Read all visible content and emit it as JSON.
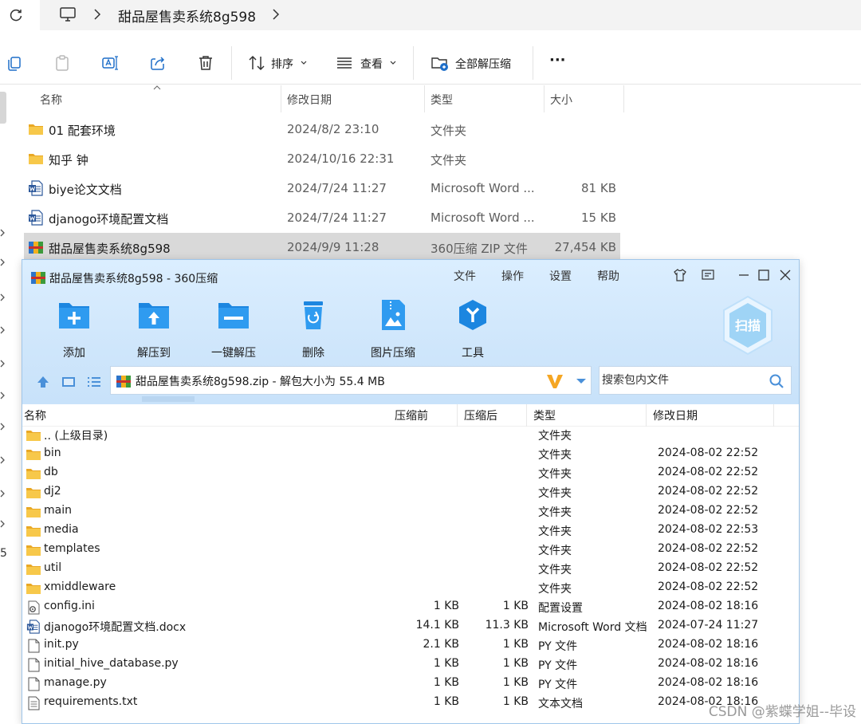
{
  "explorer": {
    "breadcrumb": "甜品屋售卖系统8g598",
    "toolbar": {
      "sort_label": "排序",
      "view_label": "查看",
      "extract_all_label": "全部解压缩",
      "more_label": "···"
    },
    "columns": {
      "name": "名称",
      "date": "修改日期",
      "type": "类型",
      "size": "大小"
    },
    "files": [
      {
        "name": "01 配套环境",
        "date": "2024/8/2 23:10",
        "type": "文件夹",
        "size": "",
        "icon": "folder-icon"
      },
      {
        "name": "知乎 钟",
        "date": "2024/10/16 22:31",
        "type": "文件夹",
        "size": "",
        "icon": "folder-icon"
      },
      {
        "name": "biye论文文档",
        "date": "2024/7/24 11:27",
        "type": "Microsoft Word ...",
        "size": "81 KB",
        "icon": "word-doc-icon"
      },
      {
        "name": "djanogo环境配置文档",
        "date": "2024/7/24 11:27",
        "type": "Microsoft Word ...",
        "size": "15 KB",
        "icon": "word-doc-icon"
      },
      {
        "name": "甜品屋售卖系统8g598",
        "date": "2024/9/9 11:28",
        "type": "360压缩 ZIP 文件",
        "size": "27,454 KB",
        "icon": "zip-archive-icon",
        "selected": true
      }
    ],
    "left_glyph": "5"
  },
  "zip": {
    "title": "甜品屋售卖系统8g598 - 360压缩",
    "menu": [
      "文件",
      "操作",
      "设置",
      "帮助"
    ],
    "tools": [
      {
        "label": "添加",
        "icon": "add-icon"
      },
      {
        "label": "解压到",
        "icon": "extract-to-icon"
      },
      {
        "label": "一键解压",
        "icon": "one-click-extract-icon"
      },
      {
        "label": "删除",
        "icon": "delete-icon"
      },
      {
        "label": "图片压缩",
        "icon": "image-compress-icon"
      },
      {
        "label": "工具",
        "icon": "tools-icon"
      }
    ],
    "scan_label": "扫描",
    "path_text": "甜品屋售卖系统8g598.zip - 解包大小为 55.4 MB",
    "search_placeholder": "搜索包内文件",
    "columns": {
      "name": "名称",
      "before": "压缩前",
      "after": "压缩后",
      "type": "类型",
      "date": "修改日期"
    },
    "rows": [
      {
        "name": ".. (上级目录)",
        "before": "",
        "after": "",
        "type": "文件夹",
        "date": "",
        "icon": "folder-icon"
      },
      {
        "name": "bin",
        "before": "",
        "after": "",
        "type": "文件夹",
        "date": "2024-08-02 22:52",
        "icon": "folder-icon"
      },
      {
        "name": "db",
        "before": "",
        "after": "",
        "type": "文件夹",
        "date": "2024-08-02 22:52",
        "icon": "folder-icon"
      },
      {
        "name": "dj2",
        "before": "",
        "after": "",
        "type": "文件夹",
        "date": "2024-08-02 22:52",
        "icon": "folder-icon"
      },
      {
        "name": "main",
        "before": "",
        "after": "",
        "type": "文件夹",
        "date": "2024-08-02 22:52",
        "icon": "folder-icon"
      },
      {
        "name": "media",
        "before": "",
        "after": "",
        "type": "文件夹",
        "date": "2024-08-02 22:53",
        "icon": "folder-icon"
      },
      {
        "name": "templates",
        "before": "",
        "after": "",
        "type": "文件夹",
        "date": "2024-08-02 22:52",
        "icon": "folder-icon"
      },
      {
        "name": "util",
        "before": "",
        "after": "",
        "type": "文件夹",
        "date": "2024-08-02 22:52",
        "icon": "folder-icon"
      },
      {
        "name": "xmiddleware",
        "before": "",
        "after": "",
        "type": "文件夹",
        "date": "2024-08-02 22:52",
        "icon": "folder-icon"
      },
      {
        "name": "config.ini",
        "before": "1 KB",
        "after": "1 KB",
        "type": "配置设置",
        "date": "2024-08-02 18:16",
        "icon": "config-file-icon"
      },
      {
        "name": "djanogo环境配置文档.docx",
        "before": "14.1 KB",
        "after": "11.3 KB",
        "type": "Microsoft Word 文档",
        "date": "2024-07-24 11:27",
        "icon": "word-doc-icon"
      },
      {
        "name": "init.py",
        "before": "2.1 KB",
        "after": "1 KB",
        "type": "PY 文件",
        "date": "2024-08-02 18:16",
        "icon": "file-icon"
      },
      {
        "name": "initial_hive_database.py",
        "before": "1 KB",
        "after": "1 KB",
        "type": "PY 文件",
        "date": "2024-08-02 18:16",
        "icon": "file-icon"
      },
      {
        "name": "manage.py",
        "before": "1 KB",
        "after": "1 KB",
        "type": "PY 文件",
        "date": "2024-08-02 18:16",
        "icon": "file-icon"
      },
      {
        "name": "requirements.txt",
        "before": "1 KB",
        "after": "1 KB",
        "type": "文本文档",
        "date": "2024-08-02 18:16",
        "icon": "text-file-icon"
      }
    ]
  },
  "watermark": "CSDN @紫蝶学姐--毕设",
  "colors": {
    "folder": "#f5c33b",
    "accent_blue": "#1f8ae6",
    "zip_header": "#d4e9fc",
    "selected_row": "#d9d9d9"
  }
}
